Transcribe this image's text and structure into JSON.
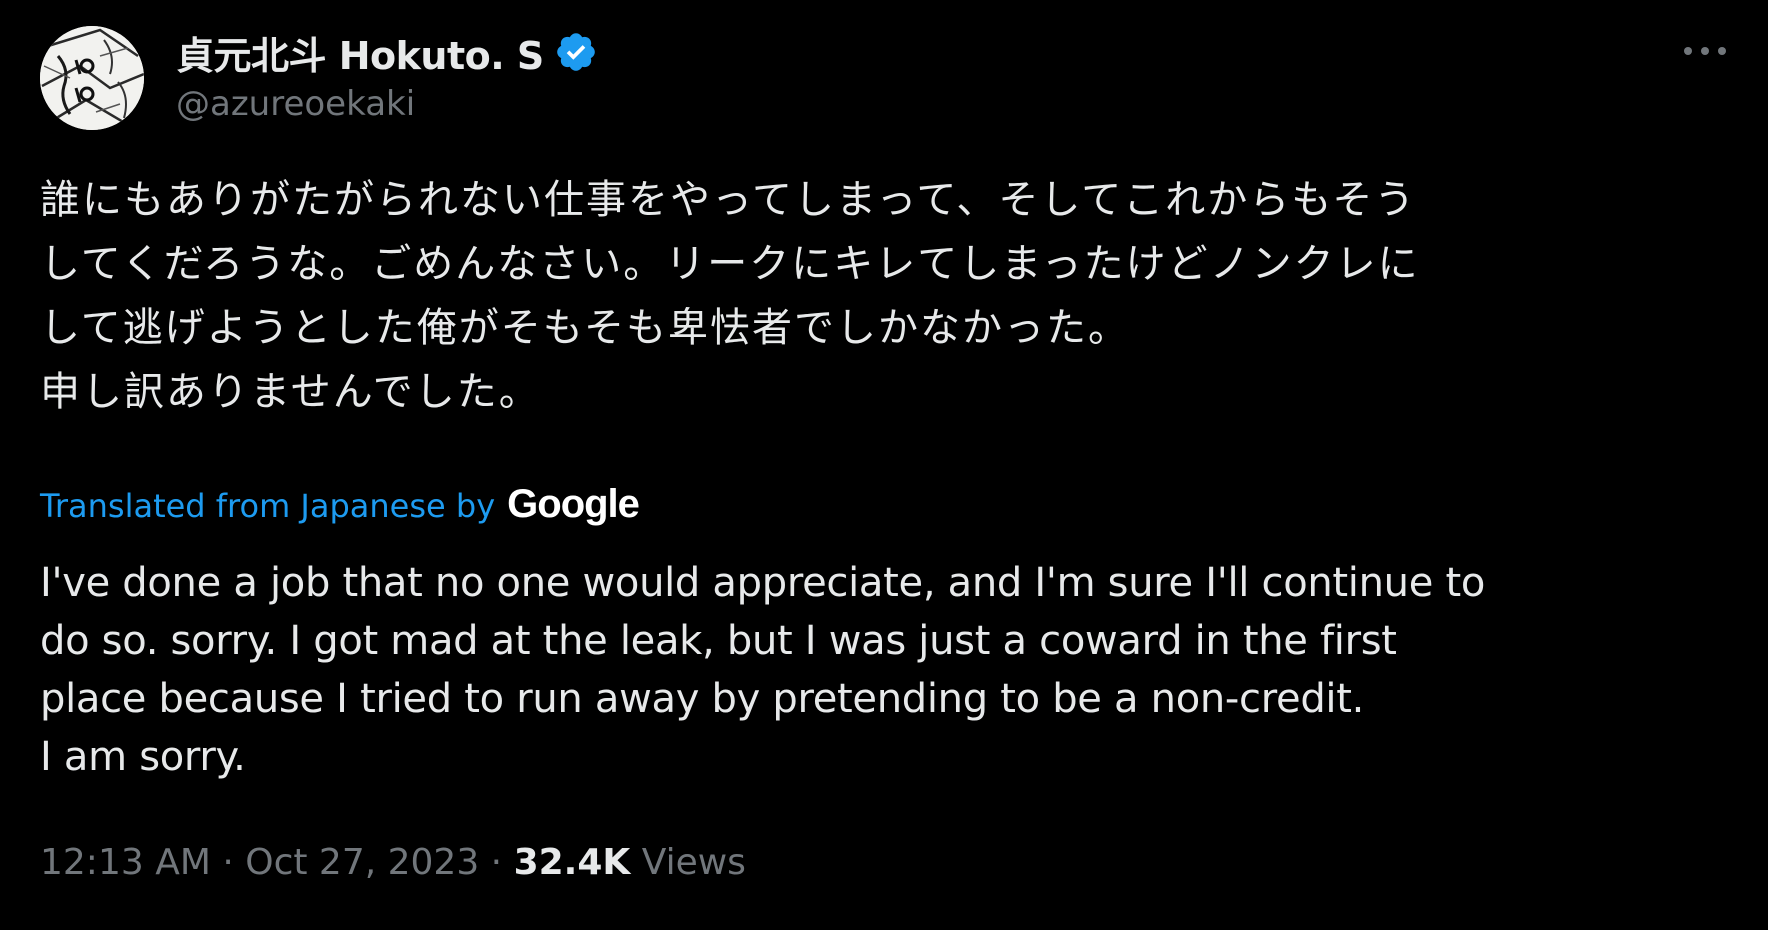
{
  "author": {
    "display_name": "貞元北斗 Hokuto. S",
    "handle": "@azureoekaki",
    "verified": true
  },
  "tweet": {
    "original_text": "誰にもありがたがられない仕事をやってしまって、そしてこれからもそう\nしてくだろうな。ごめんなさい。リークにキレてしまったけどノンクレに\nして逃げようとした俺がそもそも卑怯者でしかなかった。\n申し訳ありませんでした。",
    "translation_label": "Translated from Japanese by",
    "translation_provider": "Google",
    "translated_text": "I've done a job that no one would appreciate, and I'm sure I'll continue to\ndo so. sorry. I got mad at the leak, but I was just a coward in the first\nplace because I tried to run away by pretending to be a non-credit.\nI am sorry.",
    "time": "12:13 AM",
    "separator": " · ",
    "date": "Oct 27, 2023",
    "views_count": "32.4K",
    "views_label": "Views"
  },
  "icons": {
    "verified": "verified-badge-icon",
    "more": "more-options-icon"
  },
  "colors": {
    "background": "#000000",
    "text_primary": "#e7e9ea",
    "text_secondary": "#71767b",
    "link": "#1d9bf0",
    "verified": "#1d9bf0"
  }
}
